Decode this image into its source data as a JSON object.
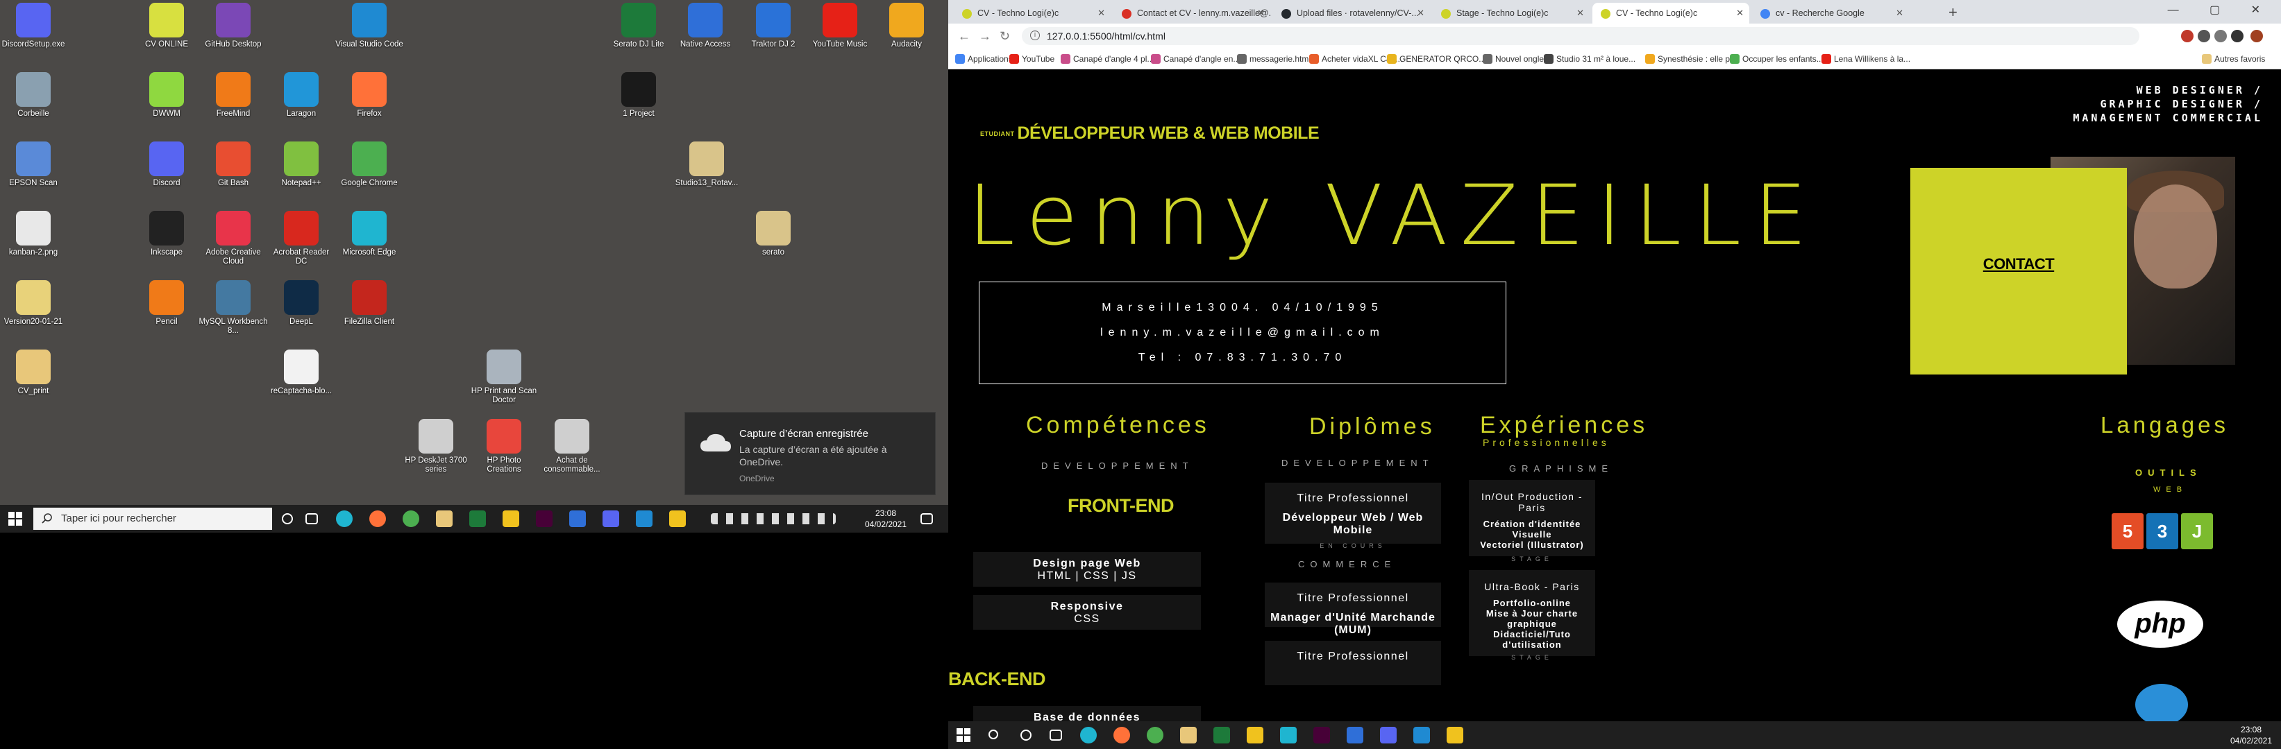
{
  "desktop": {
    "icons": [
      {
        "label": "DiscordSetup.exe",
        "icon": "discord-icon",
        "color": "#5865f2"
      },
      {
        "label": "Corbeille",
        "icon": "recycle-bin-icon",
        "color": "#8aa0b0"
      },
      {
        "label": "EPSON Scan",
        "icon": "scanner-icon",
        "color": "#5a8ad8"
      },
      {
        "label": "kanban-2.png",
        "icon": "image-file-icon",
        "color": "#e8e8e8"
      },
      {
        "label": "Version20-01-21",
        "icon": "document-icon",
        "color": "#e8d27a"
      },
      {
        "label": "CV_print",
        "icon": "folder-icon",
        "color": "#e8c77a"
      },
      {
        "label": "CV ONLINE",
        "icon": "folder-icon",
        "color": "#d8e040"
      },
      {
        "label": "DWWM",
        "icon": "folder-icon",
        "color": "#8fd840"
      },
      {
        "label": "Discord",
        "icon": "discord-icon",
        "color": "#5865f2"
      },
      {
        "label": "Inkscape",
        "icon": "inkscape-icon",
        "color": "#222222"
      },
      {
        "label": "Pencil",
        "icon": "pencil-icon",
        "color": "#f07a18"
      },
      {
        "label": "GitHub Desktop",
        "icon": "github-icon",
        "color": "#7b48b6"
      },
      {
        "label": "FreeMind",
        "icon": "freemind-icon",
        "color": "#f07a18"
      },
      {
        "label": "Git Bash",
        "icon": "git-icon",
        "color": "#e84e31"
      },
      {
        "label": "Adobe Creative Cloud",
        "icon": "creative-cloud-icon",
        "color": "#e8344a"
      },
      {
        "label": "MySQL Workbench 8...",
        "icon": "mysql-icon",
        "color": "#4479a1"
      },
      {
        "label": "Laragon",
        "icon": "laragon-icon",
        "color": "#2196d8"
      },
      {
        "label": "Notepad++",
        "icon": "notepad-icon",
        "color": "#80c040"
      },
      {
        "label": "Acrobat Reader DC",
        "icon": "acrobat-icon",
        "color": "#d8281e"
      },
      {
        "label": "DeepL",
        "icon": "deepl-icon",
        "color": "#0f2b46"
      },
      {
        "label": "reCaptacha-blo...",
        "icon": "document-icon",
        "color": "#f2f2f2"
      },
      {
        "label": "Visual Studio Code",
        "icon": "vscode-icon",
        "color": "#1f8ad2"
      },
      {
        "label": "Firefox",
        "icon": "firefox-icon",
        "color": "#ff7139"
      },
      {
        "label": "Google Chrome",
        "icon": "chrome-icon",
        "color": "#4caf50"
      },
      {
        "label": "Microsoft Edge",
        "icon": "edge-icon",
        "color": "#1fb5d0"
      },
      {
        "label": "FileZilla Client",
        "icon": "filezilla-icon",
        "color": "#c4261d"
      },
      {
        "label": "HP Print and Scan Doctor",
        "icon": "printer-icon",
        "color": "#aab4be"
      },
      {
        "label": "HP DeskJet 3700 series",
        "icon": "printer-icon",
        "color": "#cfcfcf"
      },
      {
        "label": "HP Photo Creations",
        "icon": "photo-icon",
        "color": "#e8463c"
      },
      {
        "label": "Achat de consommable...",
        "icon": "printer-icon",
        "color": "#cfcfcf"
      },
      {
        "label": "Serato DJ Lite",
        "icon": "serato-icon",
        "color": "#1d7a3a"
      },
      {
        "label": "Native Access",
        "icon": "native-access-icon",
        "color": "#2f6fd8"
      },
      {
        "label": "Traktor DJ 2",
        "icon": "traktor-icon",
        "color": "#2a72d8"
      },
      {
        "label": "YouTube Music",
        "icon": "youtube-music-icon",
        "color": "#e62117"
      },
      {
        "label": "Audacity",
        "icon": "audacity-icon",
        "color": "#f0a81e"
      },
      {
        "label": "1 Project",
        "icon": "project-icon",
        "color": "#1a1a1a"
      },
      {
        "label": "Studio13_Rotav...",
        "icon": "folder-icon",
        "color": "#d9c48a"
      },
      {
        "label": "serato",
        "icon": "folder-icon",
        "color": "#d9c48a"
      }
    ],
    "notification": {
      "title": "Capture d’écran enregistrée",
      "text": "La capture d’écran a été ajoutée à OneDrive.",
      "source": "OneDrive"
    },
    "taskbar": {
      "search_placeholder": "Taper ici pour rechercher",
      "time": "23:08",
      "date": "04/02/2021"
    }
  },
  "browser": {
    "tabs": [
      {
        "title": "CV - Techno Logi(e)c",
        "color": "#cdd328"
      },
      {
        "title": "Contact et CV - lenny.m.vazeille@...",
        "color": "#d93025"
      },
      {
        "title": "Upload files · rotavelenny/CV-...",
        "color": "#24292e"
      },
      {
        "title": "Stage - Techno Logi(e)c",
        "color": "#cdd328"
      },
      {
        "title": "CV - Techno Logi(e)c",
        "color": "#cdd328"
      },
      {
        "title": "cv - Recherche Google",
        "color": "#4285f4"
      }
    ],
    "url": "127.0.0.1:5500/html/cv.html",
    "bookmarks": [
      {
        "label": "Applications",
        "color": "#4285f4"
      },
      {
        "label": "YouTube",
        "color": "#e62117"
      },
      {
        "label": "Canapé d'angle 4 pl...",
        "color": "#c94d8a"
      },
      {
        "label": "Canapé d'angle en...",
        "color": "#c94d8a"
      },
      {
        "label": "messagerie.html",
        "color": "#666666"
      },
      {
        "label": "Acheter vidaXL Can...",
        "color": "#e85d2a"
      },
      {
        "label": "GENERATOR QRCO...",
        "color": "#e8b41e"
      },
      {
        "label": "Nouvel onglet",
        "color": "#666666"
      },
      {
        "label": "Studio 31 m² à loue...",
        "color": "#444444"
      },
      {
        "label": "Synesthésie : elle p...",
        "color": "#f0a81e"
      },
      {
        "label": "Occuper les enfants...",
        "color": "#4caf50"
      },
      {
        "label": "Lena Willikens à la...",
        "color": "#e62117"
      },
      {
        "label": "Autres favoris",
        "color": "#e8c77a"
      }
    ]
  },
  "cv": {
    "etudiant": "ETUDIANT",
    "subtitle": "DÉVELOPPEUR WEB & WEB MOBILE",
    "roles": [
      "WEB DESIGNER /",
      "GRAPHIC DESIGNER /",
      "MANAGEMENT COMMERCIAL"
    ],
    "name": "Lenny VAZEILLE",
    "info": {
      "line1": "Marseille13004. 04/10/1995",
      "line2": "lenny.m.vazeille@gmail.com",
      "line3": "Tel : 07.83.71.30.70"
    },
    "contact": "CONTACT",
    "competences": {
      "title": "Compétences",
      "category": "DEVELOPPEMENT",
      "frontend": "FRONT-END",
      "cards": [
        {
          "l1": "Design page Web",
          "l2": "HTML | CSS | JS"
        },
        {
          "l1": "Responsive",
          "l2": "CSS"
        }
      ],
      "backend": "BACK-END",
      "backend_first": "Base de données"
    },
    "diplomes": {
      "title": "Diplômes",
      "cat1": "DEVELOPPEMENT",
      "cards1": [
        {
          "l1": "Titre Professionnel",
          "l2": "Développeur Web / Web Mobile",
          "l3": "EN COURS"
        }
      ],
      "cat2": "COMMERCE",
      "cards2": [
        {
          "l1": "Titre Professionnel",
          "l2": "Manager d'Unité Marchande (MUM)"
        },
        {
          "l1": "Titre Professionnel",
          "l2": ""
        }
      ]
    },
    "experiences": {
      "title": "Expériences",
      "subtitle": "Professionnelles",
      "category": "GRAPHISME",
      "cards": [
        {
          "l1": "In/Out Production - Paris",
          "l2a": "Création d'identitée Visuelle",
          "l2b": "Vectoriel (Illustrator)",
          "l3": "STAGE"
        },
        {
          "l1": "Ultra-Book - Paris",
          "l2a": "Portfolio-online",
          "l2b": "Mise à Jour charte graphique",
          "l2c": "Didacticiel/Tuto d'utilisation",
          "l3": "STAGE"
        }
      ]
    },
    "langages": {
      "title": "Langages",
      "outils": "OUTILS",
      "web": "WEB",
      "badges": [
        {
          "text": "5",
          "color": "#e44d26",
          "icon": "html5-icon"
        },
        {
          "text": "3",
          "color": "#1572b6",
          "icon": "css3-icon"
        },
        {
          "text": "J",
          "color": "#7cbb2e",
          "icon": "js-icon"
        }
      ],
      "php": "php"
    },
    "accent": "#cdd328"
  },
  "right_taskbar": {
    "time": "23:08",
    "date": "04/02/2021"
  }
}
